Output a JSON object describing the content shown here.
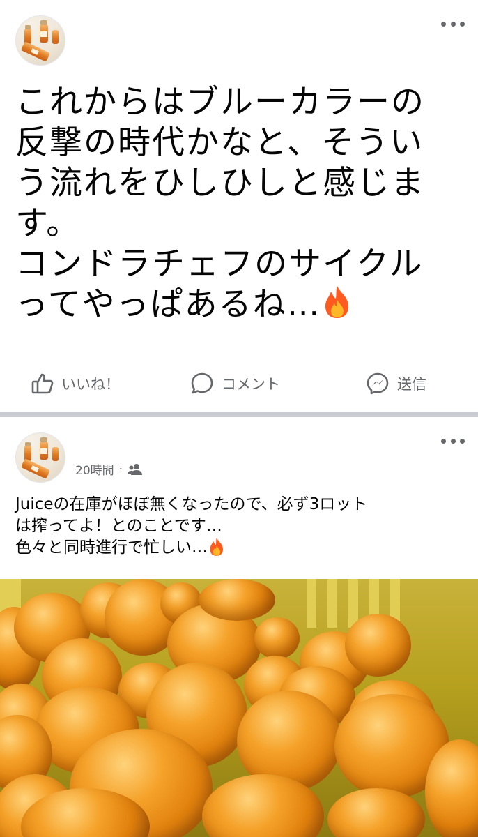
{
  "post1": {
    "text": "これからはブルーカラーの\n反撃の時代かなと、そうい\nう流れをひしひしと感じま\nす。\nコンドラチェフのサイクル\nってやっぱあるね…",
    "actions": {
      "like": "いいね！",
      "comment": "コメント",
      "send": "送信"
    }
  },
  "post2": {
    "time": "20時間",
    "separator": "·",
    "audience_icon": "friends-icon",
    "text_line1": "Juiceの在庫がほぼ無くなったので、必ず3ロット",
    "text_line2": "は搾ってよ！とのことです…",
    "text_line3": "色々と同時進行で忙しい…"
  },
  "colors": {
    "text": "#050505",
    "secondary": "#65676b",
    "separator": "#c9ccd1"
  }
}
